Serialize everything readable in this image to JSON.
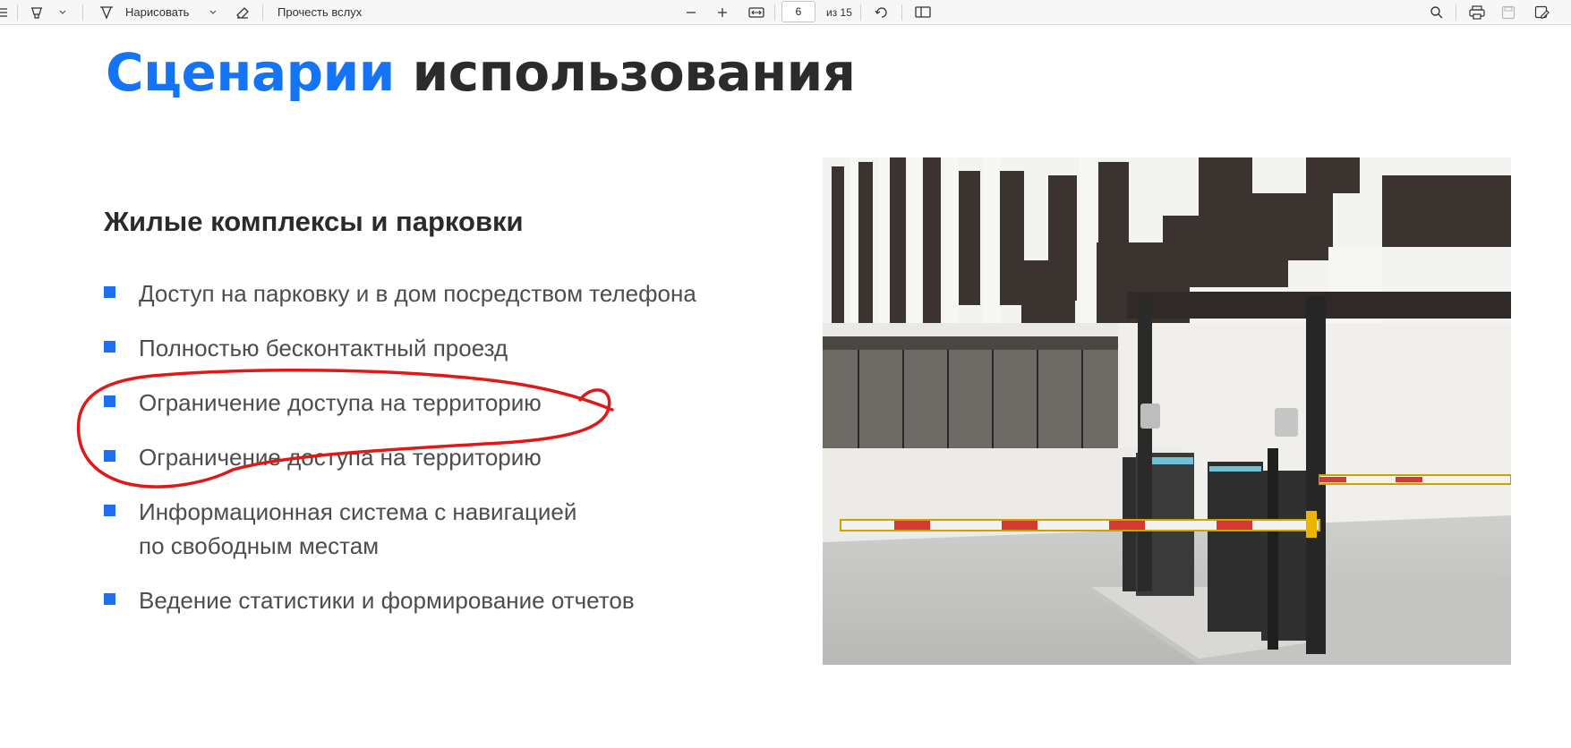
{
  "toolbar": {
    "highlight_icon": "highlighter-icon",
    "draw_label": "Нарисовать",
    "read_aloud_label": "Прочесть вслух",
    "current_page": "6",
    "page_total_label": "из 15"
  },
  "slide": {
    "title_accent": "Сценарии",
    "title_rest": "использования",
    "subtitle": "Жилые комплексы и парковки",
    "bullets": [
      "Доступ на парковку и в дом посредством телефона",
      "Полностью бесконтактный проезд",
      "Ограничение доступа на территорию",
      "Ограничение доступа на территорию",
      "Информационная система с навигацией",
      "по свободным местам",
      "Ведение статистики и формирование отчетов"
    ]
  },
  "colors": {
    "accent": "#1574f6",
    "bullet": "#1e6ff0",
    "ink_annotation": "#e01818",
    "text": "#4d4d4d"
  }
}
